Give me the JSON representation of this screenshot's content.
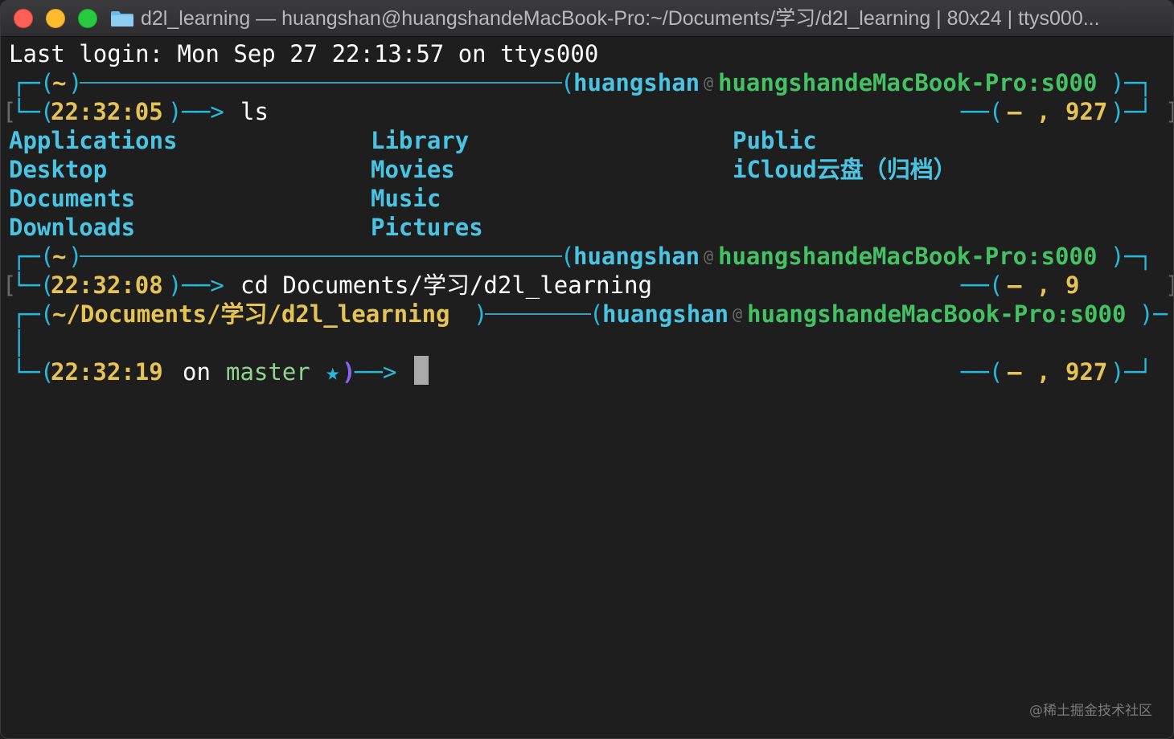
{
  "window": {
    "title": "d2l_learning — huangshan@huangshandeMacBook-Pro:~/Documents/学习/d2l_learning | 80x24 | ttys000..."
  },
  "terminal": {
    "last_login": "Last login: Mon Sep 27 22:13:57 on ttys000",
    "prompts": [
      {
        "dir": "~",
        "user": "huangshan",
        "at": "@",
        "host": "huangshandeMacBook-Pro:s000",
        "time": "22:32:05",
        "command": "ls",
        "status": "—",
        "history": "927"
      },
      {
        "dir": "~",
        "user": "huangshan",
        "at": "@",
        "host": "huangshandeMacBook-Pro:s000",
        "time": "22:32:08",
        "command": "cd Documents/学习/d2l_learning",
        "status": "—",
        "history": "9"
      },
      {
        "dir": "~/Documents/学习/d2l_learning",
        "user": "huangshan",
        "at": "@",
        "host": "huangshandeMacBook-Pro:s000",
        "time": "22:32:19",
        "on": "on",
        "branch": "master",
        "star": "★",
        "status": "—",
        "history": "927"
      }
    ],
    "ls_output": {
      "col1": [
        "Applications",
        "Desktop",
        "Documents",
        "Downloads"
      ],
      "col2": [
        "Library",
        "Movies",
        "Music",
        "Pictures"
      ],
      "col3": [
        "Public",
        "iCloud云盘（归档）"
      ]
    }
  },
  "watermark": "@稀土掘金技术社区",
  "colors": {
    "background": "#1e1e1e",
    "cyan": "#29b8db",
    "green": "#43c163",
    "yellow": "#e5c454",
    "purple": "#8a62f5"
  },
  "icons": [
    "folder-icon",
    "cursor-block"
  ]
}
